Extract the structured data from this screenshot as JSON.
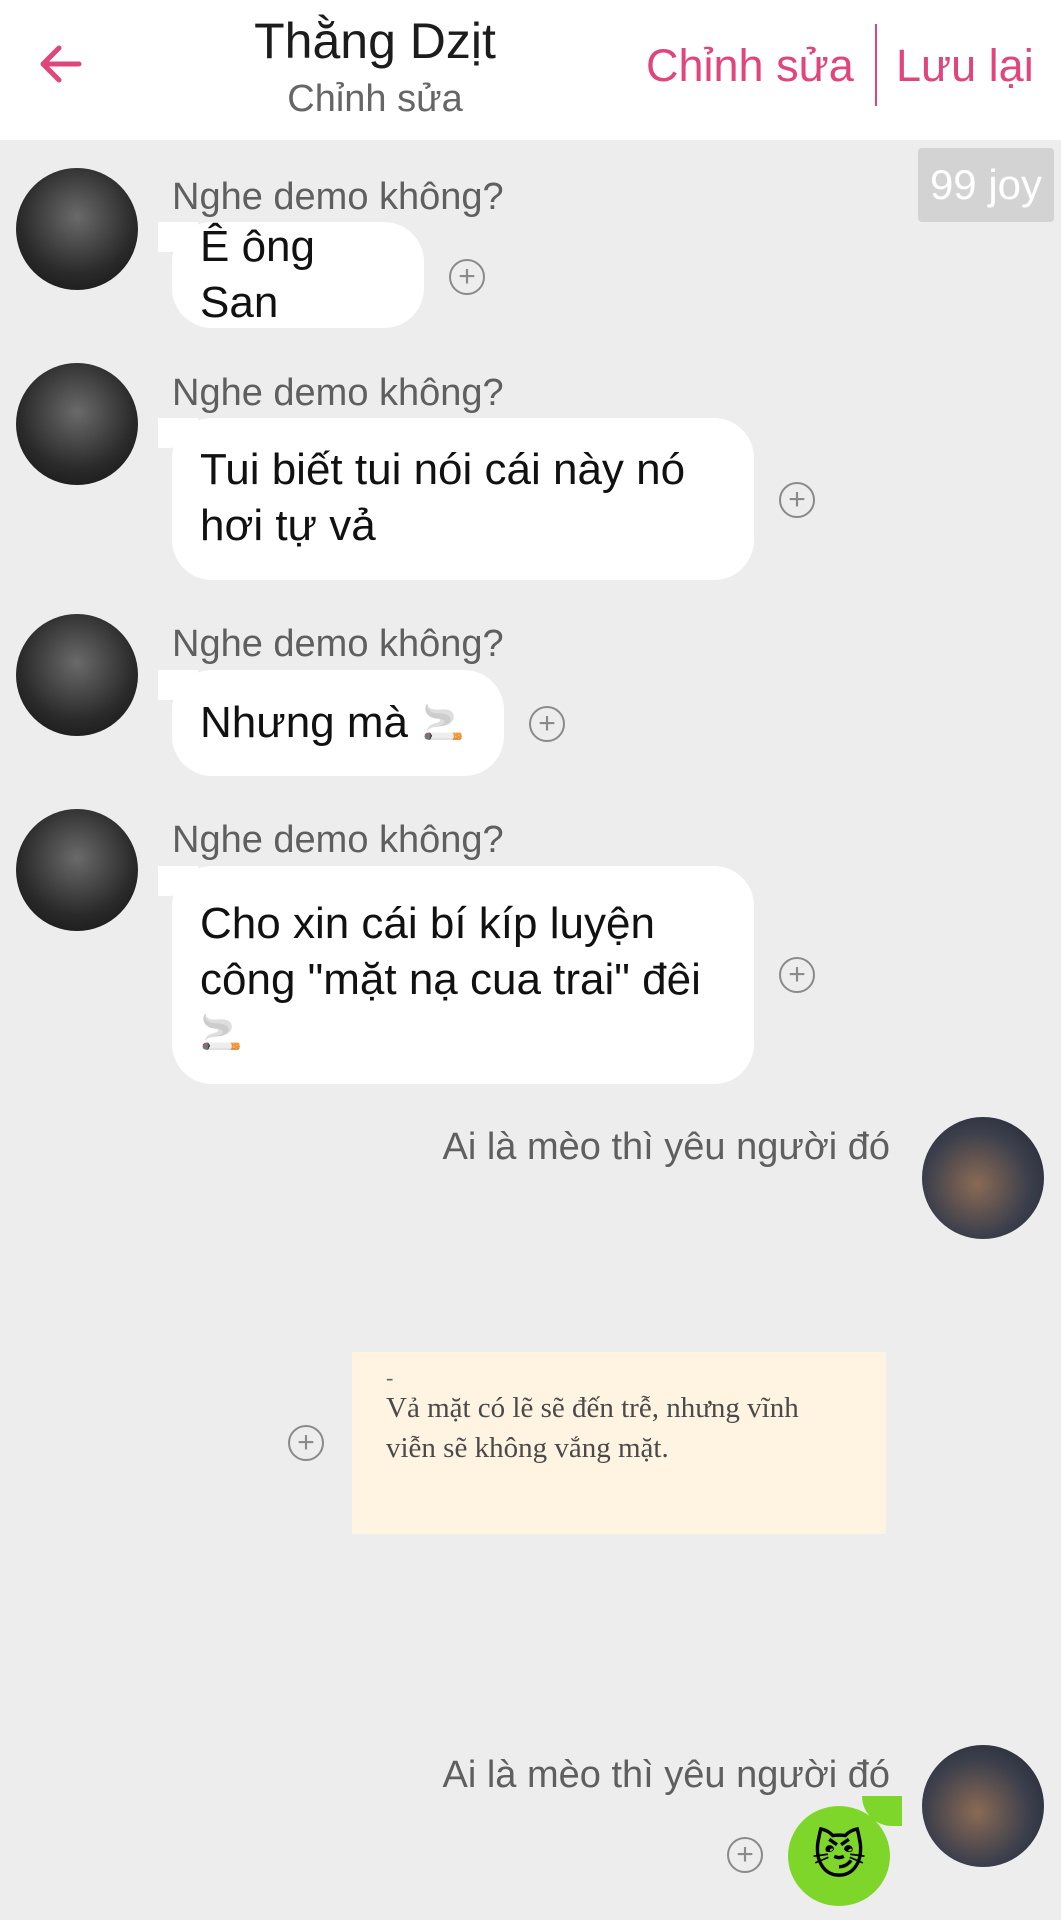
{
  "header": {
    "title": "Thằng Dzịt",
    "subtitle": "Chỉnh sửa",
    "edit_label": "Chỉnh sửa",
    "save_label": "Lưu lại",
    "accent_color": "#e0457b"
  },
  "badge": {
    "text": "99 joy"
  },
  "messages": [
    {
      "sender": "Nghe demo không?",
      "text": "Ê ông San"
    },
    {
      "sender": "Nghe demo không?",
      "line1": "Tui biết tui nói cái này nó",
      "line2": "hơi tự vả"
    },
    {
      "sender": "Nghe demo không?",
      "text": "Nhưng mà",
      "emoji": "🚬"
    },
    {
      "sender": "Nghe demo không?",
      "line1": "Cho xin cái bí kíp luyện",
      "line2": "công \"mặt nạ cua trai\" đêi",
      "emoji": "🚬"
    }
  ],
  "right_messages": [
    {
      "sender": "Ai là mèo thì yêu người đó"
    },
    {
      "sender": "Ai là mèo thì yêu người đó",
      "emoji": "😼"
    }
  ],
  "quote": {
    "dash": "-",
    "line1": "Vả mặt có lẽ sẽ đến trễ, nhưng vĩnh",
    "line2": "viễn sẽ không vắng mặt."
  },
  "icons": {
    "back": "arrow-left-icon",
    "add": "plus-circle-icon"
  }
}
